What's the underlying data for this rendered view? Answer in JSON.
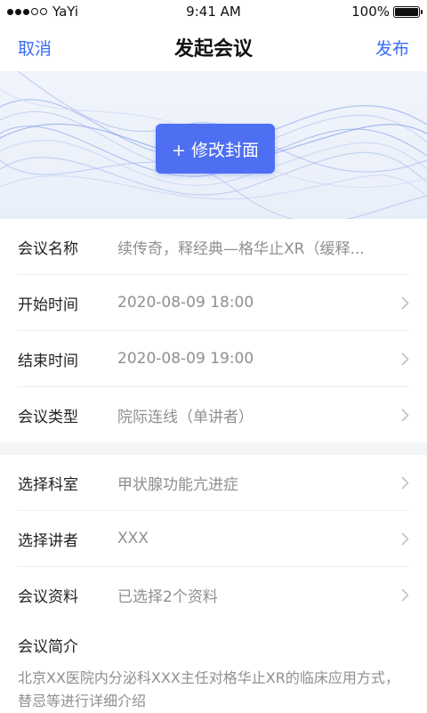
{
  "status": {
    "carrier": "YaYi",
    "time": "9:41 AM",
    "battery": "100%",
    "battery_level": 1.0
  },
  "nav": {
    "cancel": "取消",
    "title": "发起会议",
    "publish": "发布"
  },
  "cover": {
    "button_label": "+ 修改封面"
  },
  "form": {
    "section1": [
      {
        "label": "会议名称",
        "value": "续传奇，释经典—格华止XR（缓释...",
        "chevron": false
      },
      {
        "label": "开始时间",
        "value": "2020-08-09 18:00",
        "chevron": true
      },
      {
        "label": "结束时间",
        "value": "2020-08-09 19:00",
        "chevron": true
      },
      {
        "label": "会议类型",
        "value": "院际连线（单讲者）",
        "chevron": true
      }
    ],
    "section2": [
      {
        "label": "选择科室",
        "value": "甲状腺功能亢进症",
        "chevron": true
      },
      {
        "label": "选择讲者",
        "value": "XXX",
        "chevron": true
      },
      {
        "label": "会议资料",
        "value": "已选择2个资料",
        "chevron": true
      }
    ]
  },
  "intro": {
    "label": "会议简介",
    "text": "北京XX医院内分泌科XXX主任对格华止XR的临床应用方式，替忌等进行详细介绍"
  }
}
